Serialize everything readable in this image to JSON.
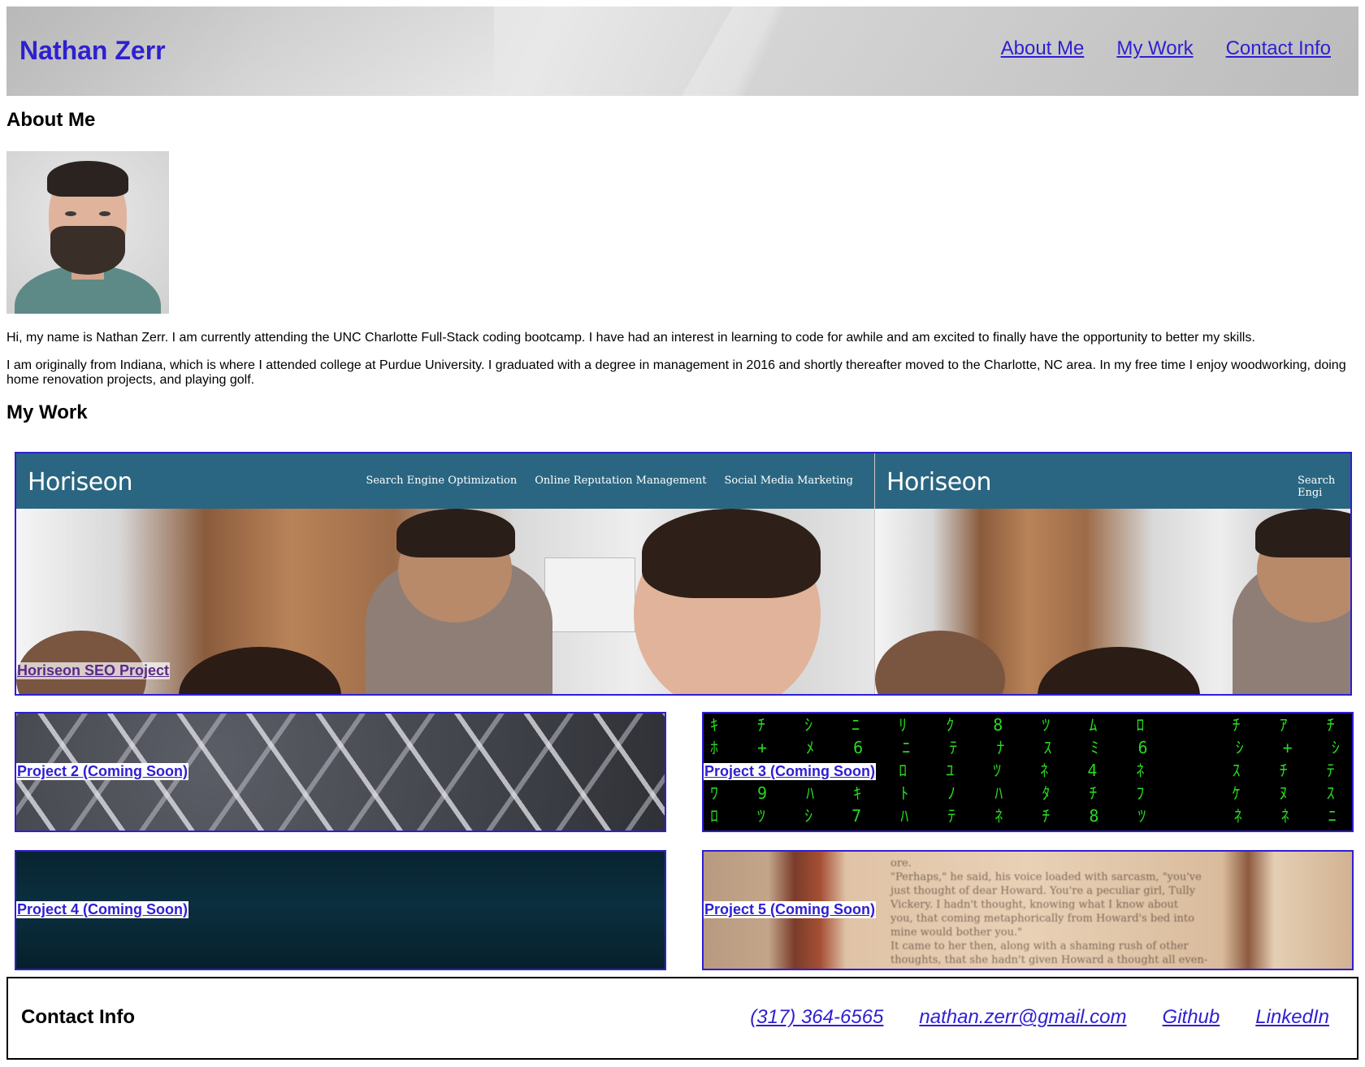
{
  "header": {
    "site_title": "Nathan Zerr",
    "nav": [
      "About Me",
      "My Work",
      "Contact Info"
    ]
  },
  "about": {
    "heading": "About Me",
    "paragraphs": [
      "Hi, my name is Nathan Zerr. I am currently attending the UNC Charlotte Full-Stack coding bootcamp. I have had an interest in learning to code for awhile and am excited to finally have the opportunity to better my skills.",
      "I am originally from Indiana, which is where I attended college at Purdue University. I graduated with a degree in management in 2016 and shortly thereafter moved to the Charlotte, NC area. In my free time I enjoy woodworking, doing home renovation projects, and playing golf."
    ]
  },
  "work": {
    "heading": "My Work",
    "projects": [
      {
        "label": "Horiseon SEO Project"
      },
      {
        "label": "Project 2 (Coming Soon)"
      },
      {
        "label": "Project 3 (Coming Soon)"
      },
      {
        "label": "Project 4 (Coming Soon)"
      },
      {
        "label": "Project 5 (Coming Soon)"
      }
    ],
    "horiseon_preview": {
      "logo": "Horiseon",
      "nav": [
        "Search Engine Optimization",
        "Online Reputation Management",
        "Social Media Marketing"
      ],
      "nav_cut": "Search Engi"
    }
  },
  "contact": {
    "heading": "Contact Info",
    "links": [
      "(317) 364-6565",
      "nathan.zerr@gmail.com",
      "Github",
      "LinkedIn"
    ]
  },
  "colors": {
    "link": "#2f1fd1",
    "visited": "#5a2a8a",
    "card_border": "#2f1fd1",
    "horiseon_bar": "#2a6681"
  }
}
